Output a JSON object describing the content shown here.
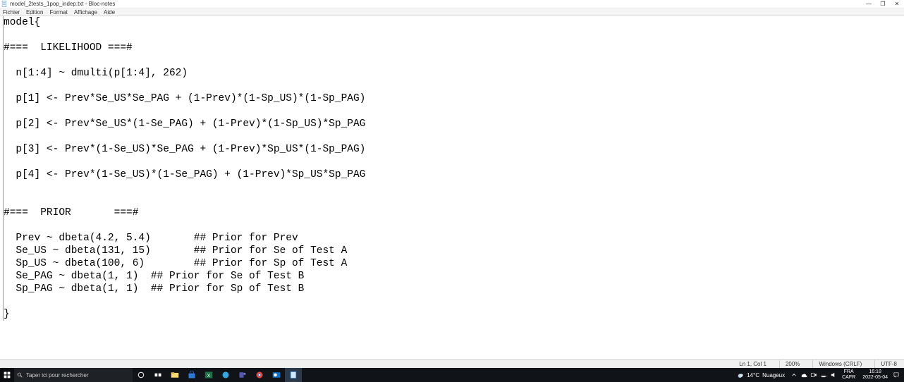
{
  "window": {
    "title": "model_2tests_1pop_indep.txt - Bloc-notes"
  },
  "menubar": {
    "items": [
      "Fichier",
      "Edition",
      "Format",
      "Affichage",
      "Aide"
    ]
  },
  "editor": {
    "content": "model{\n\n#===  LIKELIHOOD ===#\n\n  n[1:4] ~ dmulti(p[1:4], 262)\n  \n  p[1] <- Prev*Se_US*Se_PAG + (1-Prev)*(1-Sp_US)*(1-Sp_PAG)\n\n  p[2] <- Prev*Se_US*(1-Se_PAG) + (1-Prev)*(1-Sp_US)*Sp_PAG\n\n  p[3] <- Prev*(1-Se_US)*Se_PAG + (1-Prev)*Sp_US*(1-Sp_PAG)\n\n  p[4] <- Prev*(1-Se_US)*(1-Se_PAG) + (1-Prev)*Sp_US*Sp_PAG\n\n\n#===  PRIOR       ===#\n\n  Prev ~ dbeta(4.2, 5.4)       ## Prior for Prev\n  Se_US ~ dbeta(131, 15)       ## Prior for Se of Test A\n  Sp_US ~ dbeta(100, 6)        ## Prior for Sp of Test A\n  Se_PAG ~ dbeta(1, 1)  ## Prior for Se of Test B\n  Sp_PAG ~ dbeta(1, 1)  ## Prior for Sp of Test B\n\n}"
  },
  "statusbar": {
    "position": "Ln 1, Col 1",
    "zoom": "200%",
    "lineending": "Windows (CRLF)",
    "encoding": "UTF-8"
  },
  "taskbar": {
    "search_placeholder": "Taper ici pour rechercher",
    "weather_temp": "14°C",
    "weather_desc": "Nuageux",
    "lang1": "FRA",
    "lang2": "CAFR",
    "time": "16:18",
    "date": "2022-05-04"
  }
}
